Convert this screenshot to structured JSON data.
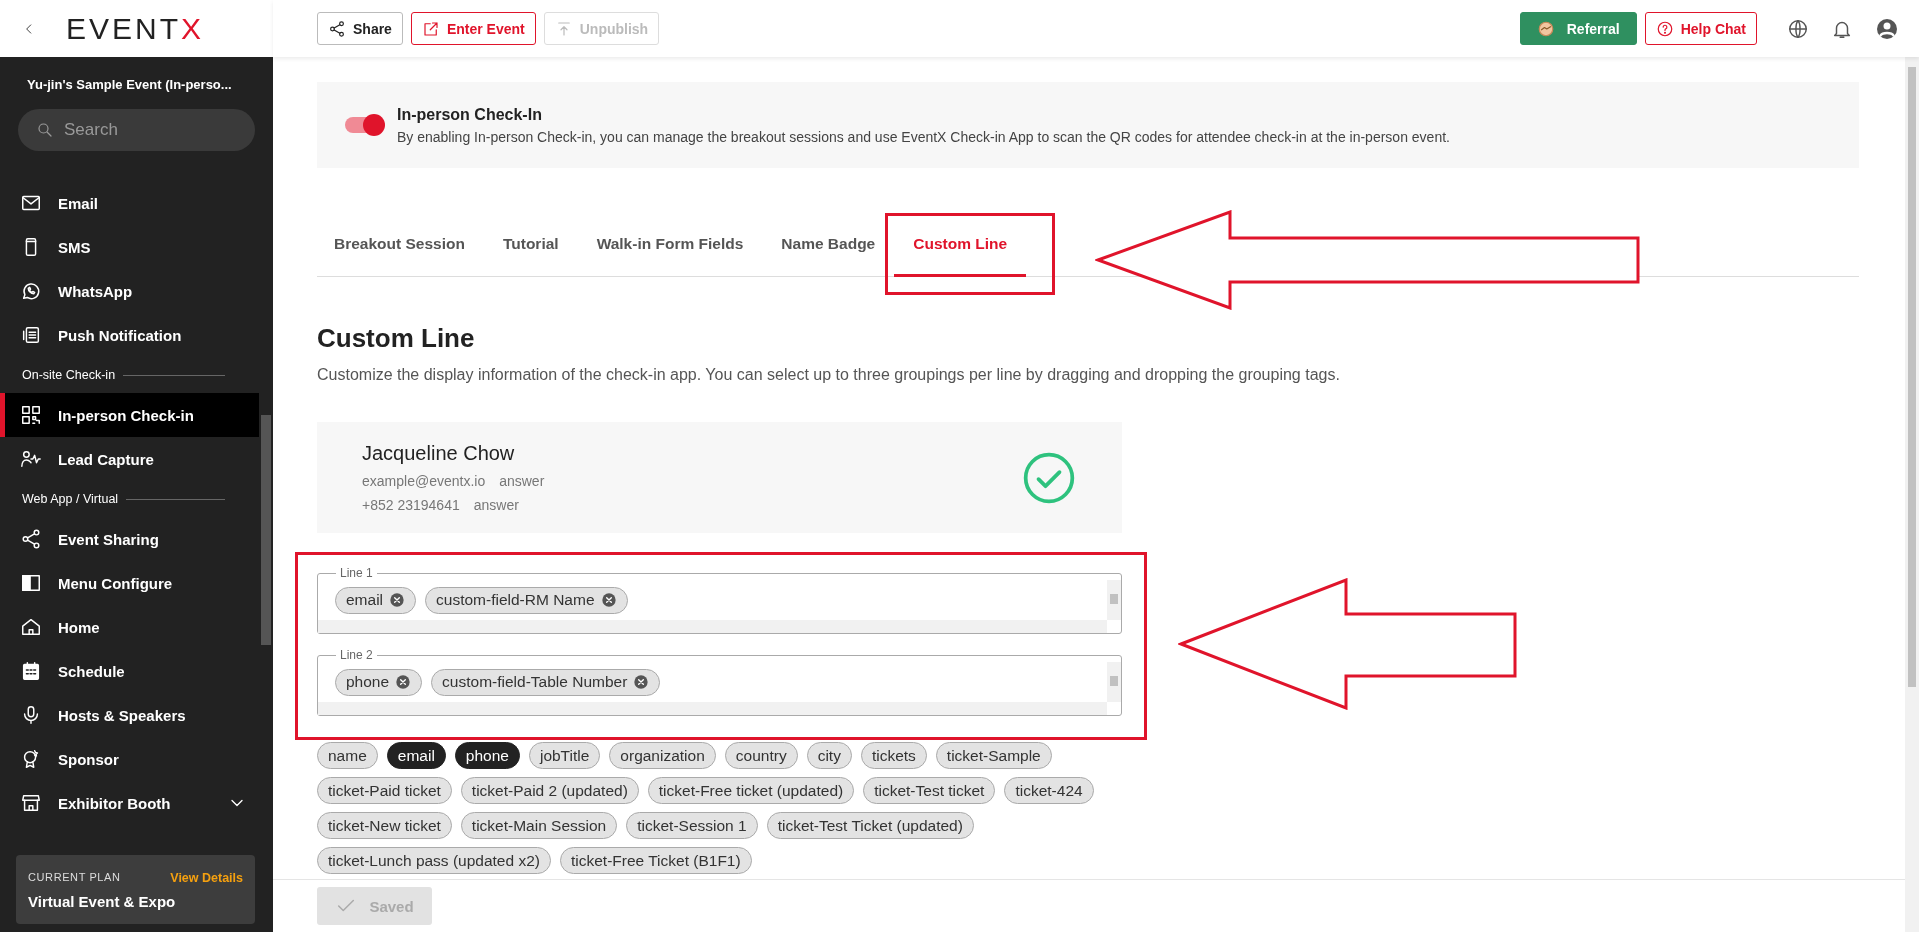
{
  "sidebar": {
    "logo": {
      "text": "EVENT",
      "accent": "X"
    },
    "event_name": "Yu-jin's Sample Event (In-perso...",
    "search": {
      "placeholder": "Search"
    },
    "items": [
      {
        "kind": "item",
        "label": "Email",
        "selected": false
      },
      {
        "kind": "item",
        "label": "SMS",
        "selected": false
      },
      {
        "kind": "item",
        "label": "WhatsApp",
        "selected": false
      },
      {
        "kind": "item",
        "label": "Push Notification",
        "selected": false
      },
      {
        "kind": "section",
        "label": "On-site Check-in"
      },
      {
        "kind": "item",
        "label": "In-person Check-in",
        "selected": true
      },
      {
        "kind": "item",
        "label": "Lead Capture",
        "selected": false
      },
      {
        "kind": "section",
        "label": "Web App / Virtual"
      },
      {
        "kind": "item",
        "label": "Event Sharing",
        "selected": false
      },
      {
        "kind": "item",
        "label": "Menu Configure",
        "selected": false
      },
      {
        "kind": "item",
        "label": "Home",
        "selected": false
      },
      {
        "kind": "item",
        "label": "Schedule",
        "selected": false
      },
      {
        "kind": "item",
        "label": "Hosts & Speakers",
        "selected": false
      },
      {
        "kind": "item",
        "label": "Sponsor",
        "selected": false
      },
      {
        "kind": "group",
        "label": "Exhibitor Booth",
        "selected": false
      }
    ],
    "plan": {
      "label": "CURRENT PLAN",
      "link": "View Details",
      "name": "Virtual Event & Expo"
    }
  },
  "toolbar": {
    "left_buttons": [
      {
        "kind": "share",
        "label": "Share",
        "disabled": false
      },
      {
        "kind": "enter",
        "label": "Enter Event",
        "disabled": false
      },
      {
        "kind": "unpublish",
        "label": "Unpublish",
        "disabled": true
      }
    ],
    "right_buttons": [
      {
        "kind": "referral",
        "label": "Referral"
      },
      {
        "kind": "help",
        "label": "Help Chat"
      }
    ]
  },
  "checkin_panel": {
    "enabled": true,
    "title": "In-person Check-In",
    "description": "By enabling In-person Check-in, you can manage the breakout sessions and use EventX Check-in App to scan the QR codes for attendee check-in at the in-person event."
  },
  "tabs": [
    {
      "label": "Breakout Session",
      "selected": false
    },
    {
      "label": "Tutorial",
      "selected": false
    },
    {
      "label": "Walk-in Form Fields",
      "selected": false
    },
    {
      "label": "Name Badge",
      "selected": false
    },
    {
      "label": "Custom Line",
      "selected": true
    }
  ],
  "section": {
    "title": "Custom Line",
    "description": "Customize the display information of the check-in app. You can select up to three groupings per line by dragging and dropping the grouping tags."
  },
  "preview": {
    "name": "Jacqueline Chow",
    "lines": [
      {
        "value": "example@eventx.io",
        "answer": "answer"
      },
      {
        "value": "+852 23194641",
        "answer": "answer"
      }
    ]
  },
  "lines": [
    {
      "legend": "Line 1",
      "tags": [
        "email",
        "custom-field-RM Name"
      ]
    },
    {
      "legend": "Line 2",
      "tags": [
        "phone",
        "custom-field-Table Number"
      ]
    }
  ],
  "tags": [
    {
      "label": "name",
      "selected": false
    },
    {
      "label": "email",
      "selected": true
    },
    {
      "label": "phone",
      "selected": true
    },
    {
      "label": "jobTitle",
      "selected": false
    },
    {
      "label": "organization",
      "selected": false
    },
    {
      "label": "country",
      "selected": false
    },
    {
      "label": "city",
      "selected": false
    },
    {
      "label": "tickets",
      "selected": false
    },
    {
      "label": "ticket-Sample",
      "selected": false
    },
    {
      "label": "ticket-Paid ticket",
      "selected": false
    },
    {
      "label": "ticket-Paid 2 (updated)",
      "selected": false
    },
    {
      "label": "ticket-Free ticket (updated)",
      "selected": false
    },
    {
      "label": "ticket-Test ticket",
      "selected": false
    },
    {
      "label": "ticket-424",
      "selected": false
    },
    {
      "label": "ticket-New ticket",
      "selected": false
    },
    {
      "label": "ticket-Main Session",
      "selected": false
    },
    {
      "label": "ticket-Session 1",
      "selected": false
    },
    {
      "label": "ticket-Test Ticket (updated)",
      "selected": false
    },
    {
      "label": "ticket-Lunch pass (updated x2)",
      "selected": false
    },
    {
      "label": "ticket-Free Ticket (B1F1)",
      "selected": false
    }
  ],
  "save_button": {
    "label": "Saved",
    "disabled": true
  }
}
